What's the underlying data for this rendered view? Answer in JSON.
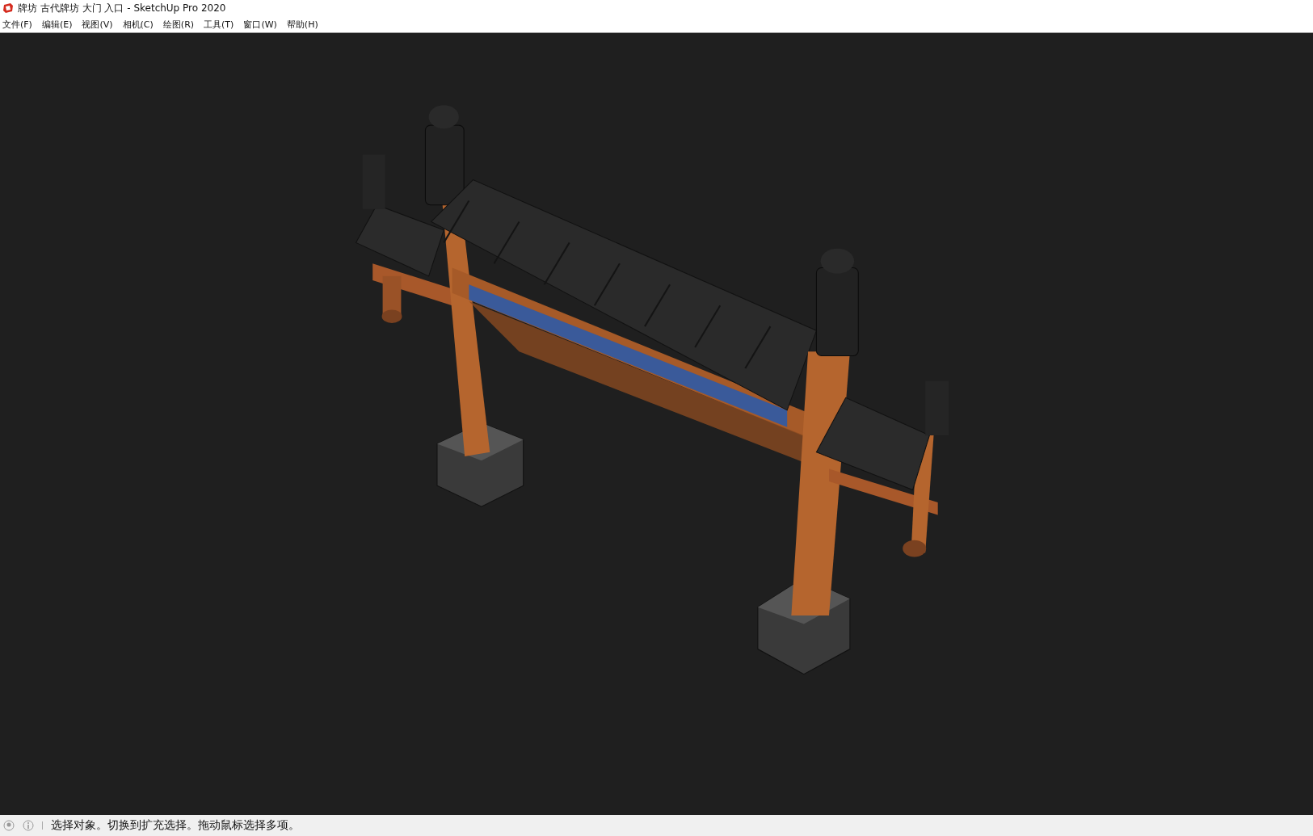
{
  "window": {
    "title": "牌坊 古代牌坊 大门 入口 - SketchUp Pro 2020"
  },
  "menu": [
    "文件(F)",
    "编辑(E)",
    "视图(V)",
    "相机(C)",
    "绘图(R)",
    "工具(T)",
    "窗口(W)",
    "帮助(H)"
  ],
  "status_bar": {
    "message": "选择对象。切换到扩充选择。拖动鼠标选择多项。"
  }
}
